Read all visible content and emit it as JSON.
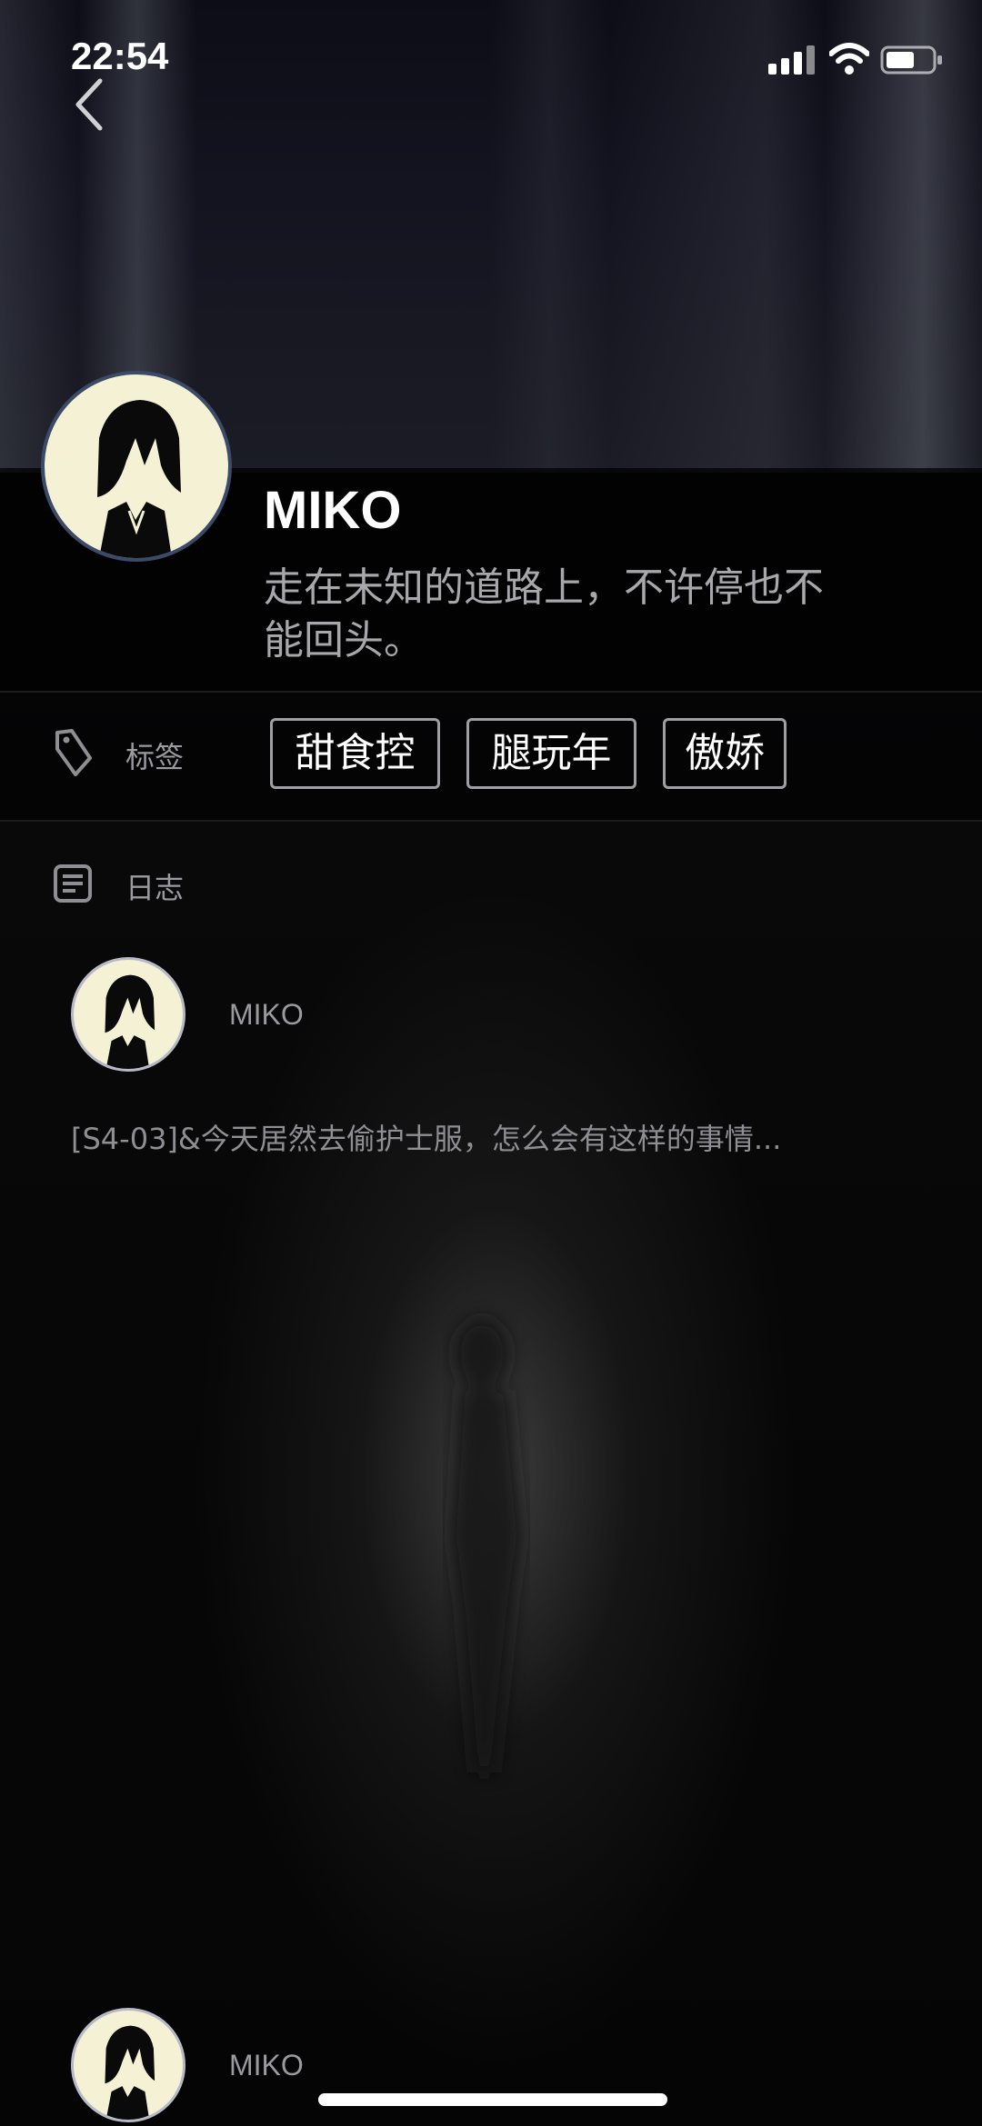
{
  "status_bar": {
    "time": "22:54"
  },
  "profile": {
    "name": "MIKO",
    "bio_line1": "走在未知的道路上，不许停也不",
    "bio_line2": "能回头。"
  },
  "tags": {
    "label": "标签",
    "items": [
      "甜食控",
      "腿玩年",
      "傲娇"
    ]
  },
  "journal": {
    "label": "日志",
    "posts": [
      {
        "author": "MIKO",
        "text": "[S4-03]&今天居然去偷护士服，怎么会有这样的事情..."
      },
      {
        "author": "MIKO"
      }
    ]
  },
  "colors": {
    "background": "#000000",
    "avatar_fill": "#f4f1d5",
    "avatar_border": "#3b4a66",
    "muted_text": "#9a9aa0",
    "chip_border": "#9f9fa3"
  },
  "icons": {
    "back": "chevron-left-icon",
    "tag": "tag-icon",
    "journal": "document-icon",
    "signal": "cellular-signal-icon",
    "wifi": "wifi-icon",
    "battery": "battery-icon"
  }
}
